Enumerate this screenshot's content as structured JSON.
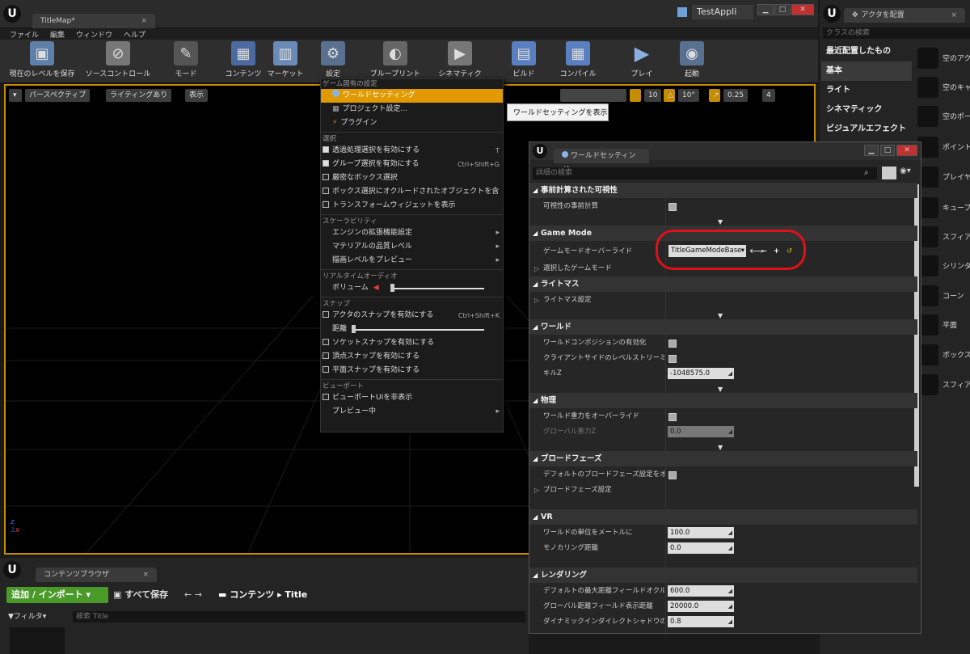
{
  "window": {
    "tab_title": "TitleMap*",
    "project_name": "TestAppli"
  },
  "menubar": [
    "ファイル",
    "編集",
    "ウィンドウ",
    "ヘルプ"
  ],
  "toolbar": [
    {
      "label": "現在のレベルを保存",
      "icon": "save-icon"
    },
    {
      "label": "ソースコントロール",
      "icon": "source-control-icon"
    },
    {
      "label": "モード",
      "icon": "modes-icon"
    },
    {
      "label": "コンテンツ",
      "icon": "content-icon"
    },
    {
      "label": "マーケット",
      "icon": "marketplace-icon"
    },
    {
      "label": "設定",
      "icon": "settings-icon"
    },
    {
      "label": "ブループリント",
      "icon": "blueprint-icon"
    },
    {
      "label": "シネマティクス",
      "icon": "cinematics-icon"
    },
    {
      "label": "ビルド",
      "icon": "build-icon"
    },
    {
      "label": "コンパイル",
      "icon": "compile-icon"
    },
    {
      "label": "プレイ",
      "icon": "play-icon"
    },
    {
      "label": "起動",
      "icon": "launch-icon"
    }
  ],
  "viewport": {
    "perspective": "パースペクティブ",
    "lighting": "ライティングあり",
    "show": "表示",
    "grid_snap": "10",
    "rot_snap": "10°",
    "scale_snap": "0.25",
    "cam_speed": "4"
  },
  "settings_menu": {
    "sections": [
      {
        "header": "ゲーム固有の設定",
        "items": [
          {
            "label": "ワールドセッティング",
            "selected": true
          },
          {
            "label": "プロジェクト設定..."
          },
          {
            "label": "プラグイン"
          }
        ]
      },
      {
        "header": "選択",
        "items": [
          {
            "label": "透過処理選択を有効にする",
            "checked": true,
            "shortcut": "T"
          },
          {
            "label": "グループ選択を有効にする",
            "checked": true,
            "shortcut": "Ctrl+Shift+G"
          },
          {
            "label": "厳密なボックス選択",
            "checked": false
          },
          {
            "label": "ボックス選択にオクルードされたオブジェクトを含む",
            "checked": false
          },
          {
            "label": "トランスフォームウィジェットを表示",
            "checked": false
          }
        ]
      },
      {
        "header": "スケーラビリティ",
        "items": [
          {
            "label": "エンジンの拡張機能設定",
            "submenu": true
          },
          {
            "label": "マテリアルの品質レベル",
            "submenu": true
          },
          {
            "label": "描画レベルをプレビュー",
            "submenu": true
          }
        ]
      },
      {
        "header": "リアルタイムオーディオ",
        "items": [
          {
            "label": "ボリューム",
            "slider": true
          }
        ]
      },
      {
        "header": "スナップ",
        "items": [
          {
            "label": "アクタのスナップを有効にする",
            "checked": false,
            "shortcut": "Ctrl+Shift+K"
          },
          {
            "label": "距離",
            "slider": true
          },
          {
            "label": "ソケットスナップを有効にする",
            "checked": false
          },
          {
            "label": "頂点スナップを有効にする",
            "checked": false
          },
          {
            "label": "平面スナップを有効にする",
            "checked": false
          }
        ]
      },
      {
        "header": "ビューポート",
        "items": [
          {
            "label": "ビューポートUIを非表示",
            "checked": false
          },
          {
            "label": "プレビュー中",
            "submenu": true
          }
        ]
      }
    ]
  },
  "tooltip": "ワールドセッティングを表示",
  "place_actors": {
    "tab": "アクタを配置",
    "search_placeholder": "クラスの検索",
    "categories": [
      "最近配置したもの",
      "基本",
      "ライト",
      "シネマティック",
      "ビジュアルエフェクト"
    ],
    "items": [
      "空のアク",
      "空のキャ",
      "空のポー",
      "ポイント",
      "プレイヤ",
      "キューブ",
      "スフィア",
      "シリンダ",
      "コーン",
      "平面",
      "ボックス",
      "スフィア"
    ]
  },
  "world_settings": {
    "tab": "ワールドセッティング",
    "search_placeholder": "詳細の検索",
    "rows": [
      {
        "type": "cat",
        "label": "事前計算された可視性"
      },
      {
        "type": "check",
        "label": "可視性の事前計算"
      },
      {
        "type": "more"
      },
      {
        "type": "cat",
        "label": "Game Mode"
      },
      {
        "type": "gamemode",
        "label": "ゲームモードオーバーライド",
        "value": "TitleGameModeBase"
      },
      {
        "type": "sub",
        "label": "選択したゲームモード"
      },
      {
        "type": "cat",
        "label": "ライトマス"
      },
      {
        "type": "sub",
        "label": "ライトマス設定"
      },
      {
        "type": "more"
      },
      {
        "type": "cat",
        "label": "ワールド"
      },
      {
        "type": "check",
        "label": "ワールドコンポジションの有効化"
      },
      {
        "type": "check",
        "label": "クライアントサイドのレベルストリーミング"
      },
      {
        "type": "num",
        "label": "キルZ",
        "value": "-1048575.0"
      },
      {
        "type": "more"
      },
      {
        "type": "cat",
        "label": "物理"
      },
      {
        "type": "check",
        "label": "ワールド重力をオーバーライド"
      },
      {
        "type": "num",
        "label": "グローバル重力Z",
        "value": "0.0",
        "disabled": true
      },
      {
        "type": "more"
      },
      {
        "type": "cat",
        "label": "ブロードフェーズ"
      },
      {
        "type": "check",
        "label": "デフォルトのブロードフェーズ設定をオーバ"
      },
      {
        "type": "sub",
        "label": "ブロードフェーズ設定"
      },
      {
        "type": "gap"
      },
      {
        "type": "cat",
        "label": "VR"
      },
      {
        "type": "num",
        "label": "ワールドの単位をメートルに",
        "value": "100.0"
      },
      {
        "type": "num",
        "label": "モノカリング距離",
        "value": "0.0"
      },
      {
        "type": "gap"
      },
      {
        "type": "cat",
        "label": "レンダリング"
      },
      {
        "type": "num",
        "label": "デフォルトの最大距離フィールドオクルージ",
        "value": "600.0"
      },
      {
        "type": "num",
        "label": "グローバル距離フィールド表示距離",
        "value": "20000.0"
      },
      {
        "type": "num",
        "label": "ダイナミックインダイレクトシャドウのセル",
        "value": "0.8"
      }
    ]
  },
  "content_browser": {
    "tab": "コンテンツブラウザ",
    "add_import": "追加 / インポート",
    "save_all": "すべて保存",
    "path_root": "コンテンツ",
    "path_current": "Title",
    "filter": "フィルタ",
    "search_placeholder": "検索 Title"
  },
  "colors": {
    "accent": "#e09a00",
    "highlight_ring": "#e0101a",
    "add_button": "#4a9a2a"
  }
}
